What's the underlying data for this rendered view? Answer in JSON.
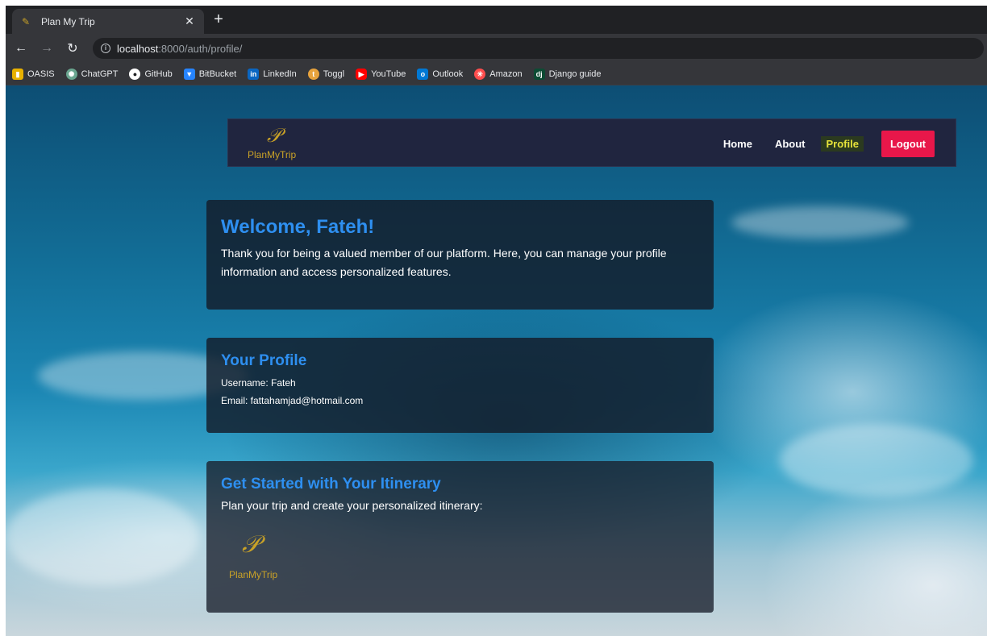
{
  "browser": {
    "tab_title": "Plan My Trip",
    "url_host": "localhost",
    "url_path": ":8000/auth/profile/",
    "bookmarks": [
      {
        "label": "OASIS",
        "icon": "oasis-icon",
        "color": "#e8b100"
      },
      {
        "label": "ChatGPT",
        "icon": "chatgpt-icon",
        "color": "#6aa58f"
      },
      {
        "label": "GitHub",
        "icon": "github-icon",
        "color": "#ffffff"
      },
      {
        "label": "BitBucket",
        "icon": "bitbucket-icon",
        "color": "#2684ff"
      },
      {
        "label": "LinkedIn",
        "icon": "linkedin-icon",
        "color": "#0a66c2"
      },
      {
        "label": "Toggl",
        "icon": "toggl-icon",
        "color": "#e57cd8"
      },
      {
        "label": "YouTube",
        "icon": "youtube-icon",
        "color": "#ff0000"
      },
      {
        "label": "Outlook",
        "icon": "outlook-icon",
        "color": "#0078d4"
      },
      {
        "label": "Amazon",
        "icon": "amazon-icon",
        "color": "#ff4d4d"
      },
      {
        "label": "Django guide",
        "icon": "django-icon",
        "color": "#0c4b33"
      }
    ]
  },
  "navbar": {
    "logo_text": "PlanMyTrip",
    "links": {
      "home": "Home",
      "about": "About",
      "profile": "Profile"
    },
    "logout_label": "Logout"
  },
  "welcome": {
    "title": "Welcome, Fateh!",
    "text": "Thank you for being a valued member of our platform. Here, you can manage your profile information and access personalized features."
  },
  "profile": {
    "title": "Your Profile",
    "username_line": "Username: Fateh",
    "email_line": "Email: fattahamjad@hotmail.com"
  },
  "itinerary": {
    "title": "Get Started with Your Itinerary",
    "text": "Plan your trip and create your personalized itinerary:",
    "logo_text": "PlanMyTrip"
  },
  "colors": {
    "accent_blue": "#2e8ff0",
    "logout_red": "#e8174a",
    "navbar_bg": "#20253f",
    "logo_gold": "#c9a227"
  }
}
